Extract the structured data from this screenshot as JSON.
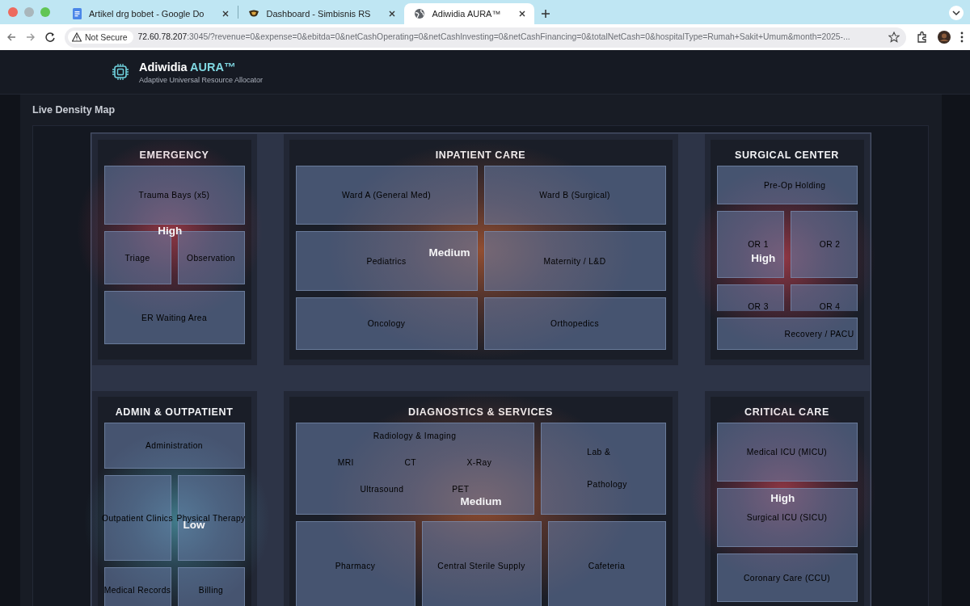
{
  "browser": {
    "tabs": [
      {
        "title": "Artikel drg bobet - Google Do",
        "kind": "docs",
        "selected": false
      },
      {
        "title": "Dashboard - Simbisnis RS",
        "kind": "site",
        "selected": false
      },
      {
        "title": "Adiwidia AURA™",
        "kind": "globe",
        "selected": true
      }
    ],
    "security": "Not Secure",
    "url": {
      "host": "72.60.78.207",
      "rest": ":3045/?revenue=0&expense=0&ebitda=0&netCashOperating=0&netCashInvesting=0&netCashFinancing=0&totalNetCash=0&hospitalType=Rumah+Sakit+Umum&month=2025-..."
    }
  },
  "header": {
    "title": "Adiwidia",
    "title_accent": "AURA™",
    "subtitle": "Adaptive Universal Resource Allocator"
  },
  "map": {
    "title": "Live Density Map",
    "zones": [
      {
        "name": "EMERGENCY",
        "density": {
          "label": "High",
          "kind": "high"
        },
        "rooms": [
          {
            "name": "Trauma Bays (x5)"
          },
          {
            "name": "Triage"
          },
          {
            "name": "Observation"
          },
          {
            "name": "ER Waiting Area"
          }
        ]
      },
      {
        "name": "INPATIENT CARE",
        "density": {
          "label": "Medium",
          "kind": "medium"
        },
        "rooms": [
          {
            "name": "Ward A (General Med)"
          },
          {
            "name": "Ward B (Surgical)"
          },
          {
            "name": "Pediatrics"
          },
          {
            "name": "Maternity / L&D"
          },
          {
            "name": "Oncology"
          },
          {
            "name": "Orthopedics"
          }
        ]
      },
      {
        "name": "SURGICAL CENTER",
        "density": {
          "label": "High",
          "kind": "high"
        },
        "rooms": [
          {
            "name": "Pre-Op Holding"
          },
          {
            "name": "OR 1"
          },
          {
            "name": "OR 2"
          },
          {
            "name": "OR 3"
          },
          {
            "name": "OR 4"
          },
          {
            "name": "Recovery / PACU"
          }
        ]
      },
      {
        "name": "ADMIN & OUTPATIENT",
        "density": {
          "label": "Low",
          "kind": "low"
        },
        "rooms": [
          {
            "name": "Administration"
          },
          {
            "name": "Outpatient Clinics"
          },
          {
            "name": "Physical Therapy"
          },
          {
            "name": "Medical Records"
          },
          {
            "name": "Billing"
          }
        ]
      },
      {
        "name": "DIAGNOSTICS & SERVICES",
        "density": {
          "label": "Medium",
          "kind": "medium"
        },
        "rooms": [
          {
            "name": "Radiology & Imaging",
            "kind": "imaging",
            "modalities": [
              [
                "MRI",
                "CT",
                "X-Ray"
              ],
              [
                "Ultrasound",
                "PET"
              ]
            ]
          },
          {
            "name": "Lab & Pathology",
            "kind": "stacked"
          },
          {
            "name": "Pharmacy"
          },
          {
            "name": "Central Sterile Supply"
          },
          {
            "name": "Cafeteria"
          }
        ]
      },
      {
        "name": "CRITICAL CARE",
        "density": {
          "label": "High",
          "kind": "high"
        },
        "rooms": [
          {
            "name": "Medical ICU (MICU)"
          },
          {
            "name": "Surgical ICU (SICU)"
          },
          {
            "name": "Coronary Care (CCU)"
          }
        ]
      }
    ]
  }
}
